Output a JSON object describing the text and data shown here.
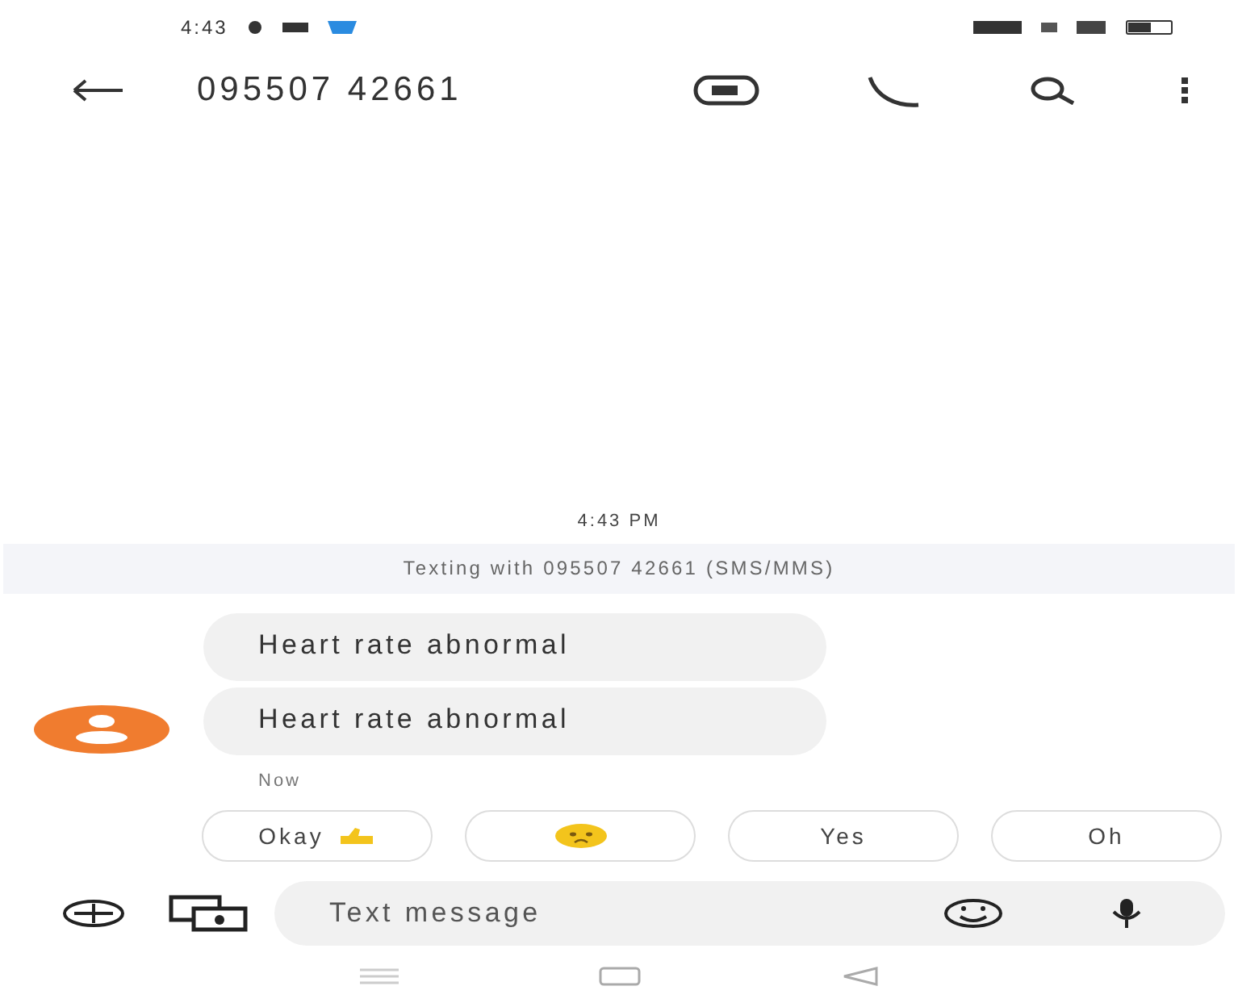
{
  "status_bar": {
    "time": "4:43"
  },
  "header": {
    "title": "095507 42661"
  },
  "conversation": {
    "timestamp": "4:43 PM",
    "banner": "Texting with 095507 42661 (SMS/MMS)",
    "messages": [
      {
        "text": "Heart rate abnormal"
      },
      {
        "text": "Heart rate abnormal"
      }
    ],
    "meta": "Now"
  },
  "suggestions": [
    {
      "kind": "text_emoji",
      "label": "Okay"
    },
    {
      "kind": "emoji"
    },
    {
      "kind": "text",
      "label": "Yes"
    },
    {
      "kind": "text",
      "label": "Oh"
    }
  ],
  "composer": {
    "placeholder": "Text message"
  }
}
